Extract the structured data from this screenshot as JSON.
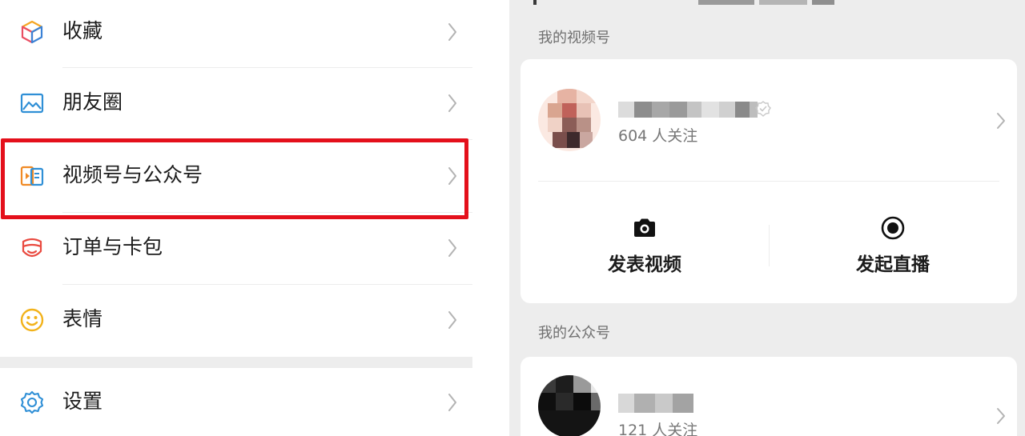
{
  "left_menu": {
    "items": [
      {
        "id": "favorites",
        "label": "收藏",
        "icon": "favorites-cube-icon"
      },
      {
        "id": "moments",
        "label": "朋友圈",
        "icon": "moments-picture-icon"
      },
      {
        "id": "channels",
        "label": "视频号与公众号",
        "icon": "channels-icon",
        "highlighted": true
      },
      {
        "id": "orders",
        "label": "订单与卡包",
        "icon": "orders-bag-icon"
      },
      {
        "id": "stickers",
        "label": "表情",
        "icon": "stickers-smile-icon"
      },
      {
        "id": "settings",
        "label": "设置",
        "icon": "settings-gear-icon"
      }
    ],
    "highlight_color": "#e4101b"
  },
  "channels_section": {
    "title": "我的视频号",
    "account": {
      "followers_text": "604 人关注",
      "verified": true
    },
    "actions": [
      {
        "label": "发表视频",
        "icon": "camera-icon"
      },
      {
        "label": "发起直播",
        "icon": "live-record-icon"
      }
    ]
  },
  "official_section": {
    "title": "我的公众号",
    "account": {
      "followers_text": "121 人关注"
    }
  },
  "colors": {
    "panel_bg": "#ededed",
    "card_bg": "#ffffff",
    "secondary_text": "#767676"
  }
}
